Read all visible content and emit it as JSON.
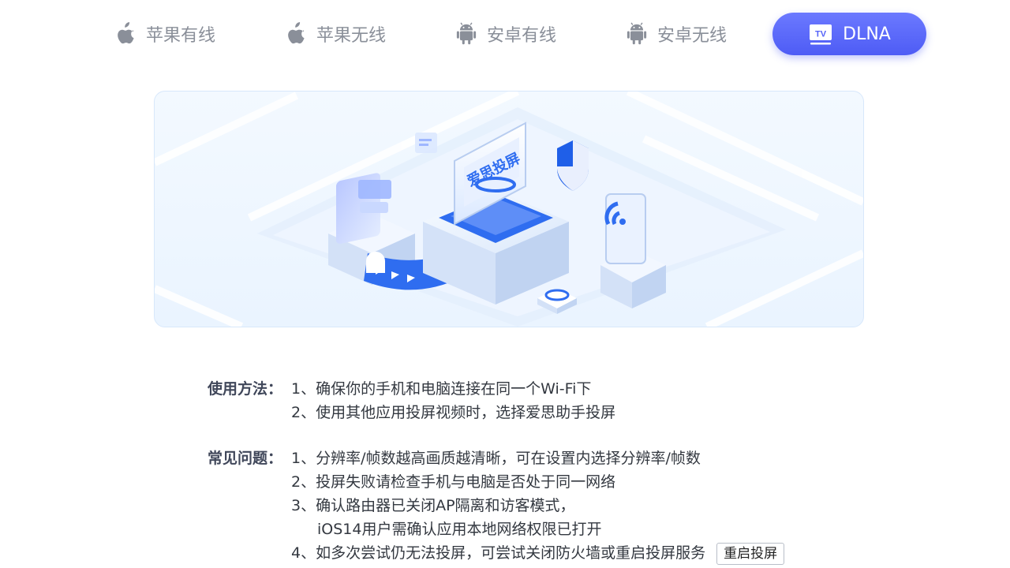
{
  "tabs": [
    {
      "label": "苹果有线",
      "icon": "apple-icon",
      "active": false
    },
    {
      "label": "苹果无线",
      "icon": "apple-icon",
      "active": false
    },
    {
      "label": "安卓有线",
      "icon": "android-icon",
      "active": false
    },
    {
      "label": "安卓无线",
      "icon": "android-icon",
      "active": false
    },
    {
      "label": "DLNA",
      "icon": "tv-icon",
      "active": true
    }
  ],
  "hero": {
    "screen_text": "爱思投屏",
    "icons": [
      "phone-icon",
      "monitor-icon",
      "shield-icon",
      "wifi-icon",
      "router-icon"
    ]
  },
  "usage": {
    "label": "使用方法：",
    "items": [
      "1、确保你的手机和电脑连接在同一个Wi-Fi下",
      "2、使用其他应用投屏视频时，选择爱思助手投屏"
    ]
  },
  "faq": {
    "label": "常见问题：",
    "items": [
      "1、分辨率/帧数越高画质越清晰，可在设置内选择分辨率/帧数",
      "2、投屏失败请检查手机与电脑是否处于同一网络",
      "3、确认路由器已关闭AP隔离和访客模式，",
      "iOS14用户需确认应用本地网络权限已打开",
      "4、如多次尝试仍无法投屏，可尝试关闭防火墙或重启投屏服务"
    ],
    "restart_button": "重启投屏"
  },
  "colors": {
    "accent": "#5563f8",
    "tab_inactive": "#8a8f99",
    "hero_blue": "#2f6df0"
  }
}
